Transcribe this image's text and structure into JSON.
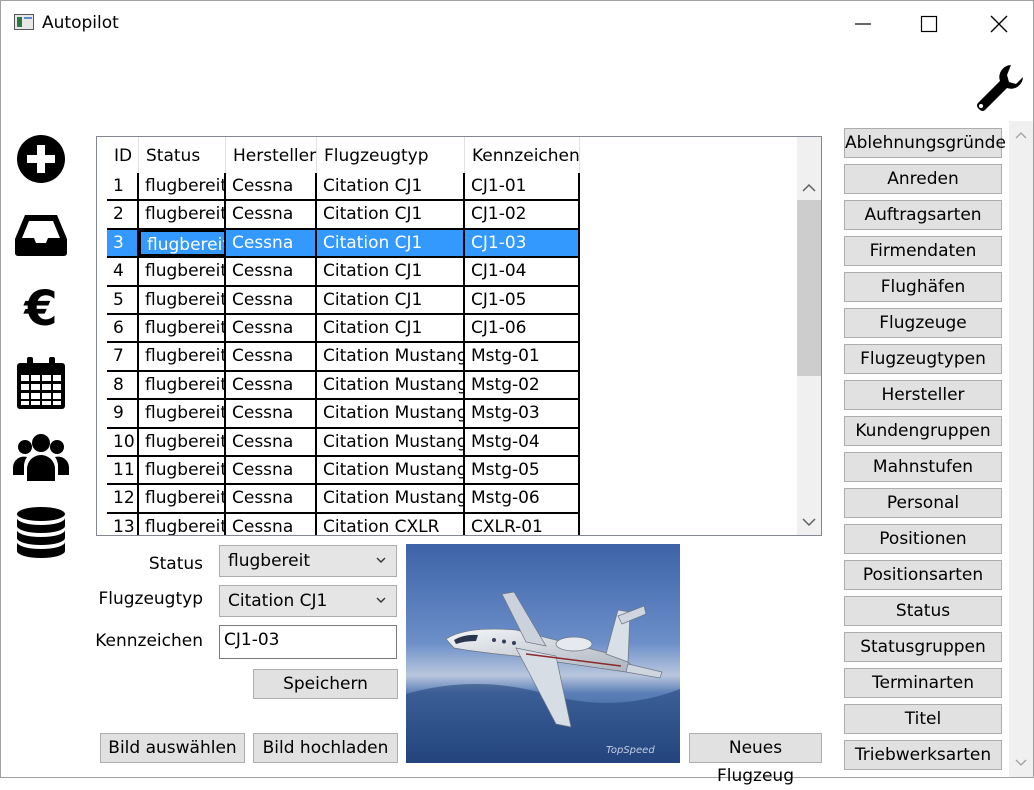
{
  "window": {
    "title": "Autopilot"
  },
  "grid": {
    "columns": [
      "ID",
      "Status",
      "Hersteller",
      "Flugzeugtyp",
      "Kennzeichen"
    ],
    "rows": [
      [
        "1",
        "flugbereit",
        "Cessna",
        "Citation CJ1",
        "CJ1-01"
      ],
      [
        "2",
        "flugbereit",
        "Cessna",
        "Citation CJ1",
        "CJ1-02"
      ],
      [
        "3",
        "flugbereit",
        "Cessna",
        "Citation CJ1",
        "CJ1-03"
      ],
      [
        "4",
        "flugbereit",
        "Cessna",
        "Citation CJ1",
        "CJ1-04"
      ],
      [
        "5",
        "flugbereit",
        "Cessna",
        "Citation CJ1",
        "CJ1-05"
      ],
      [
        "6",
        "flugbereit",
        "Cessna",
        "Citation CJ1",
        "CJ1-06"
      ],
      [
        "7",
        "flugbereit",
        "Cessna",
        "Citation Mustang",
        "Mstg-01"
      ],
      [
        "8",
        "flugbereit",
        "Cessna",
        "Citation Mustang",
        "Mstg-02"
      ],
      [
        "9",
        "flugbereit",
        "Cessna",
        "Citation Mustang",
        "Mstg-03"
      ],
      [
        "10",
        "flugbereit",
        "Cessna",
        "Citation Mustang",
        "Mstg-04"
      ],
      [
        "11",
        "flugbereit",
        "Cessna",
        "Citation Mustang",
        "Mstg-05"
      ],
      [
        "12",
        "flugbereit",
        "Cessna",
        "Citation Mustang",
        "Mstg-06"
      ],
      [
        "13",
        "flugbereit",
        "Cessna",
        "Citation CXLR",
        "CXLR-01"
      ]
    ],
    "selected_row": 2
  },
  "form": {
    "status_label": "Status",
    "status_value": "flugbereit",
    "type_label": "Flugzeugtyp",
    "type_value": "Citation CJ1",
    "reg_label": "Kennzeichen",
    "reg_value": "CJ1-03",
    "save": "Speichern",
    "choose_image": "Bild auswählen",
    "upload_image": "Bild hochladen",
    "new_aircraft": "Neues Flugzeug",
    "watermark": "TopSpeed"
  },
  "sidebar_icons": [
    "add-icon",
    "inbox-icon",
    "euro-icon",
    "calendar-icon",
    "users-icon",
    "database-icon"
  ],
  "settings_icon": "wrench-icon",
  "right_menu": [
    "Ablehnungsgründe",
    "Anreden",
    "Auftragsarten",
    "Firmendaten",
    "Flughäfen",
    "Flugzeuge",
    "Flugzeugtypen",
    "Hersteller",
    "Kundengruppen",
    "Mahnstufen",
    "Personal",
    "Positionen",
    "Positionsarten",
    "Status",
    "Statusgruppen",
    "Terminarten",
    "Titel",
    "Triebwerksarten"
  ],
  "colors": {
    "selection": "#3399ff",
    "button": "#e1e1e1",
    "scrollbar": "#f0f0f0"
  }
}
